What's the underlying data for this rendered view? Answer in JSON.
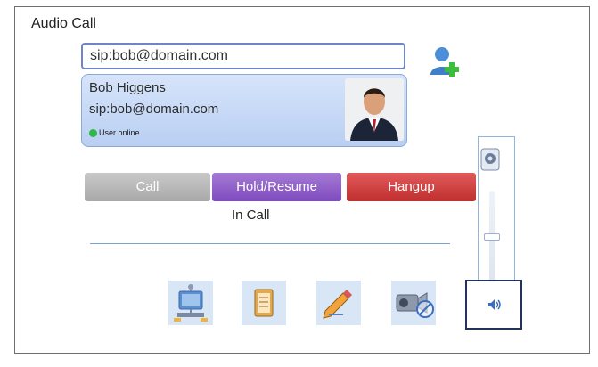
{
  "window": {
    "title": "Audio Call"
  },
  "dial": {
    "value": "sip:bob@domain.com"
  },
  "contact": {
    "name": "Bob Higgens",
    "sip": "sip:bob@domain.com",
    "presence": "User online"
  },
  "buttons": {
    "call": "Call",
    "hold_resume": "Hold/Resume",
    "hangup": "Hangup"
  },
  "call_status": "In Call",
  "volume": {
    "level": 0.5
  },
  "icons": {
    "add_contact": "add-contact-icon",
    "network": "network-icon",
    "contacts": "contact-book-icon",
    "notes": "pencil-notes-icon",
    "video": "video-camera-off-icon",
    "speaker": "speaker-icon",
    "volume_device": "volume-icon"
  },
  "colors": {
    "hold": "#7e4bbd",
    "hangup": "#bf2f2f",
    "call_disabled": "#a9a9a9",
    "online": "#2fb64a"
  }
}
